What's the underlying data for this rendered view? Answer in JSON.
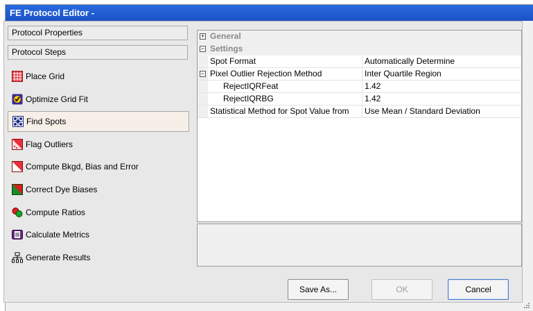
{
  "window": {
    "title": "FE Protocol Editor -"
  },
  "left_panel": {
    "protocol_properties": "Protocol Properties",
    "protocol_steps": "Protocol Steps",
    "steps": [
      {
        "label": "Place Grid",
        "icon": "grid-icon"
      },
      {
        "label": "Optimize Grid Fit",
        "icon": "optimize-icon"
      },
      {
        "label": "Find Spots",
        "icon": "find-spots-icon",
        "selected": true
      },
      {
        "label": "Flag Outliers",
        "icon": "flag-outliers-icon"
      },
      {
        "label": "Compute Bkgd, Bias and Error",
        "icon": "compute-bkgd-icon"
      },
      {
        "label": "Correct Dye Biases",
        "icon": "correct-dye-icon"
      },
      {
        "label": "Compute Ratios",
        "icon": "ratios-icon"
      },
      {
        "label": "Calculate Metrics",
        "icon": "metrics-icon"
      },
      {
        "label": "Generate Results",
        "icon": "results-icon"
      }
    ]
  },
  "property_grid": {
    "categories": {
      "general": "General",
      "settings": "Settings"
    },
    "rows": [
      {
        "name": "Spot Format",
        "value": "Automatically Determine"
      },
      {
        "name": "Pixel Outlier Rejection Method",
        "value": "Inter Quartile Region"
      },
      {
        "name": "RejectIQRFeat",
        "value": "1.42"
      },
      {
        "name": "RejectIQRBG",
        "value": "1.42"
      },
      {
        "name": "Statistical Method for Spot Value from",
        "value": "Use Mean / Standard Deviation"
      }
    ]
  },
  "buttons": {
    "save_as": "Save As...",
    "ok": "OK",
    "cancel": "Cancel"
  },
  "colors": {
    "title_bar": "#1e5bd0",
    "selected_step": "#f6efe8"
  }
}
